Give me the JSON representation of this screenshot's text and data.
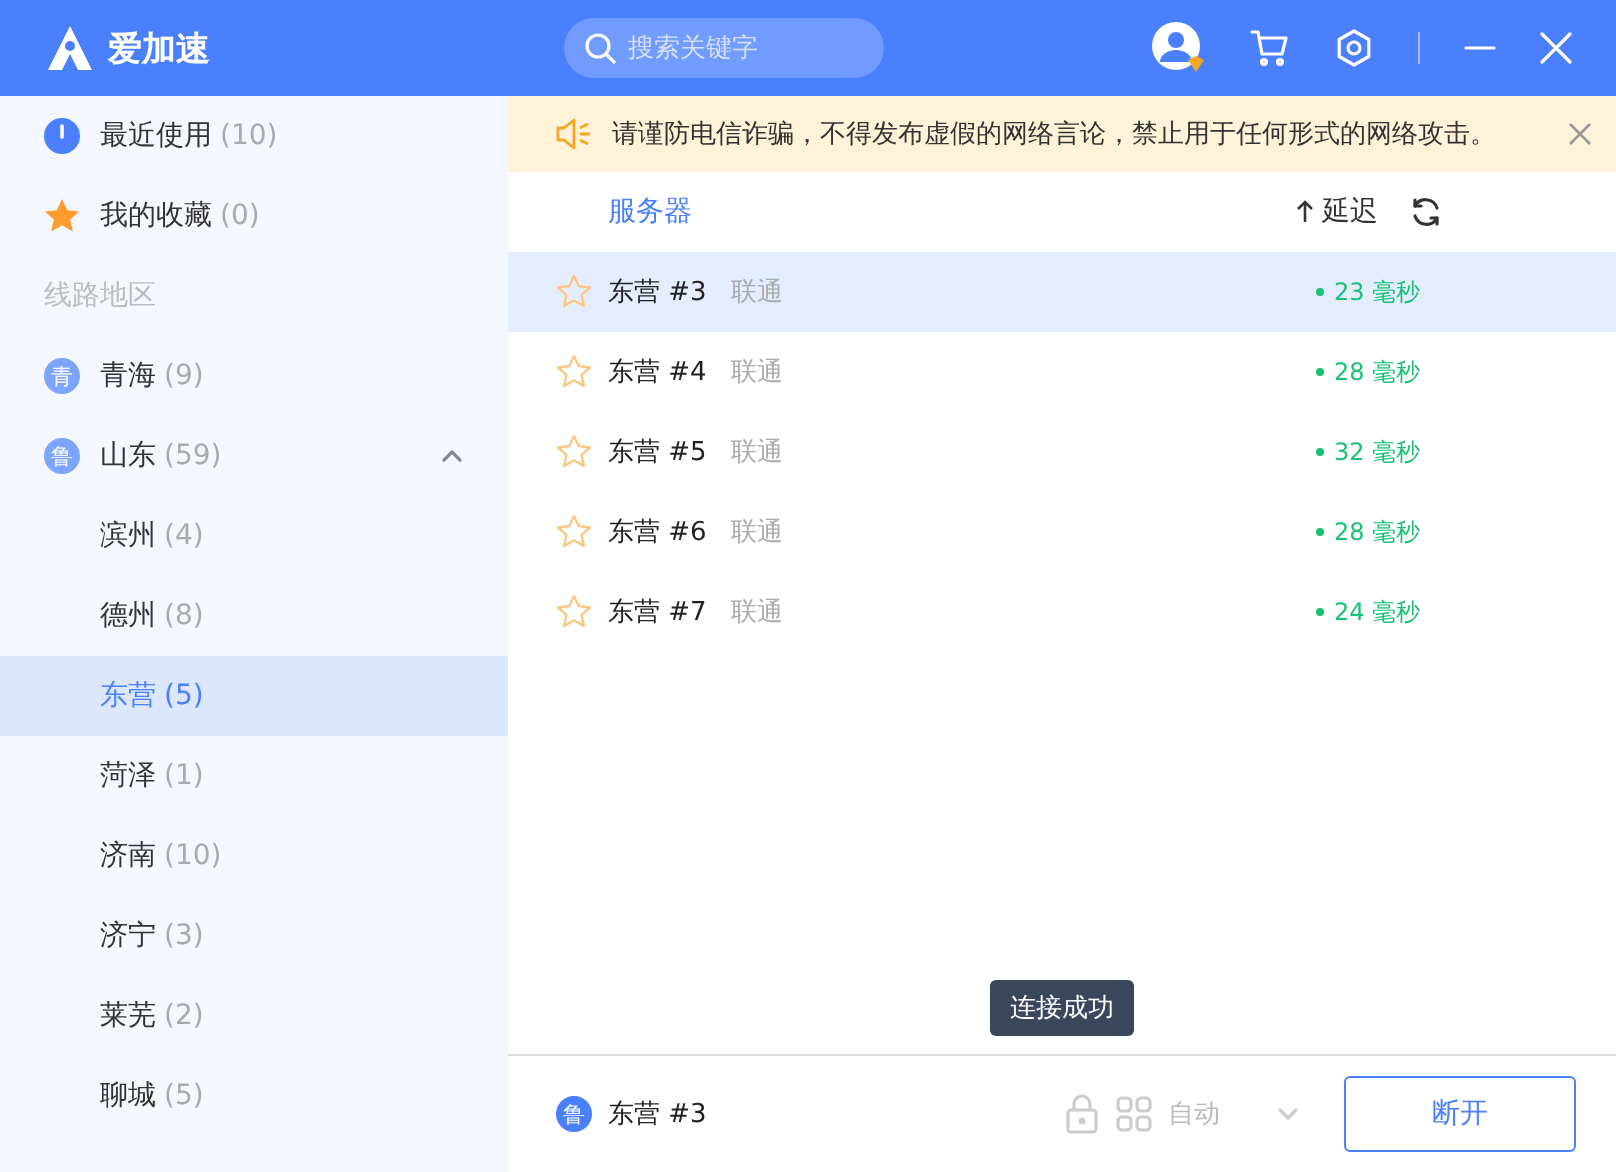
{
  "header": {
    "app_name": "爱加速",
    "search": {
      "placeholder": "搜索关键字"
    }
  },
  "sidebar": {
    "quick": [
      {
        "kind": "recent",
        "label": "最近使用",
        "count": "(10)"
      },
      {
        "kind": "favorites",
        "label": "我的收藏",
        "count": "(0)"
      }
    ],
    "section_title": "线路地区",
    "regions": [
      {
        "badge": "青",
        "label": "青海",
        "count": "(9)",
        "expanded": false
      },
      {
        "badge": "鲁",
        "label": "山东",
        "count": "(59)",
        "expanded": true,
        "children": [
          {
            "label": "滨州",
            "count": "(4)",
            "selected": false
          },
          {
            "label": "德州",
            "count": "(8)",
            "selected": false
          },
          {
            "label": "东营",
            "count": "(5)",
            "selected": true
          },
          {
            "label": "菏泽",
            "count": "(1)",
            "selected": false
          },
          {
            "label": "济南",
            "count": "(10)",
            "selected": false
          },
          {
            "label": "济宁",
            "count": "(3)",
            "selected": false
          },
          {
            "label": "莱芜",
            "count": "(2)",
            "selected": false
          },
          {
            "label": "聊城",
            "count": "(5)",
            "selected": false
          }
        ]
      }
    ]
  },
  "notice": {
    "text": "请谨防电信诈骗，不得发布虚假的网络言论，禁止用于任何形式的网络攻击。"
  },
  "list": {
    "columns": {
      "server": "服务器",
      "latency": "延迟"
    },
    "rows": [
      {
        "name": "东营 #3",
        "isp": "联通",
        "latency": "23 毫秒",
        "selected": true,
        "favorite": false
      },
      {
        "name": "东营 #4",
        "isp": "联通",
        "latency": "28 毫秒",
        "selected": false,
        "favorite": false
      },
      {
        "name": "东营 #5",
        "isp": "联通",
        "latency": "32 毫秒",
        "selected": false,
        "favorite": false
      },
      {
        "name": "东营 #6",
        "isp": "联通",
        "latency": "28 毫秒",
        "selected": false,
        "favorite": false
      },
      {
        "name": "东营 #7",
        "isp": "联通",
        "latency": "24 毫秒",
        "selected": false,
        "favorite": false
      }
    ]
  },
  "tooltip": "连接成功",
  "footer": {
    "badge": "鲁",
    "server": "东营 #3",
    "mode": "自动",
    "button": "断开"
  }
}
